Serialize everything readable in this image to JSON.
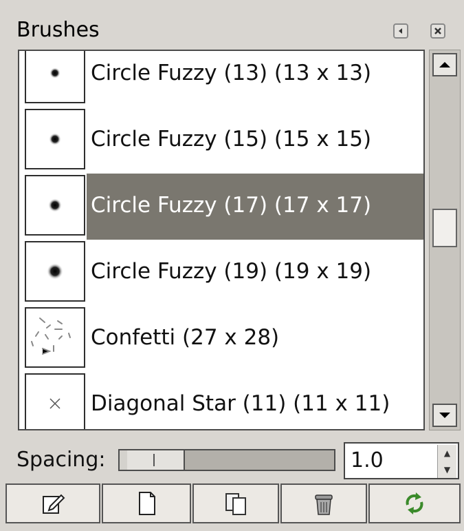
{
  "panel": {
    "title": "Brushes",
    "header_buttons": [
      {
        "icon": "tab-menu-icon"
      },
      {
        "icon": "close-icon"
      }
    ]
  },
  "brushes": [
    {
      "name": "Circle Fuzzy (13) (13 x 13)",
      "icon": "circle-fuzzy-13-icon",
      "selected": false
    },
    {
      "name": "Circle Fuzzy (15) (15 x 15)",
      "icon": "circle-fuzzy-15-icon",
      "selected": false
    },
    {
      "name": "Circle Fuzzy (17) (17 x 17)",
      "icon": "circle-fuzzy-17-icon",
      "selected": true
    },
    {
      "name": "Circle Fuzzy (19) (19 x 19)",
      "icon": "circle-fuzzy-19-icon",
      "selected": false
    },
    {
      "name": "Confetti (27 x 28)",
      "icon": "confetti-icon",
      "selected": false
    },
    {
      "name": "Diagonal Star (11) (11 x 11)",
      "icon": "diagonal-star-icon",
      "selected": false
    }
  ],
  "scrollbar": {
    "position_fraction": 0.42
  },
  "spacing": {
    "label": "Spacing:",
    "value": "1.0",
    "slider_fraction": 0.05
  },
  "actions": [
    {
      "name": "edit-brush",
      "icon": "edit-icon"
    },
    {
      "name": "new-brush",
      "icon": "new-document-icon"
    },
    {
      "name": "duplicate-brush",
      "icon": "duplicate-icon"
    },
    {
      "name": "delete-brush",
      "icon": "trash-icon"
    },
    {
      "name": "refresh-brushes",
      "icon": "refresh-icon"
    }
  ],
  "colors": {
    "selection": "#7a776f",
    "background": "#d9d6d1"
  }
}
